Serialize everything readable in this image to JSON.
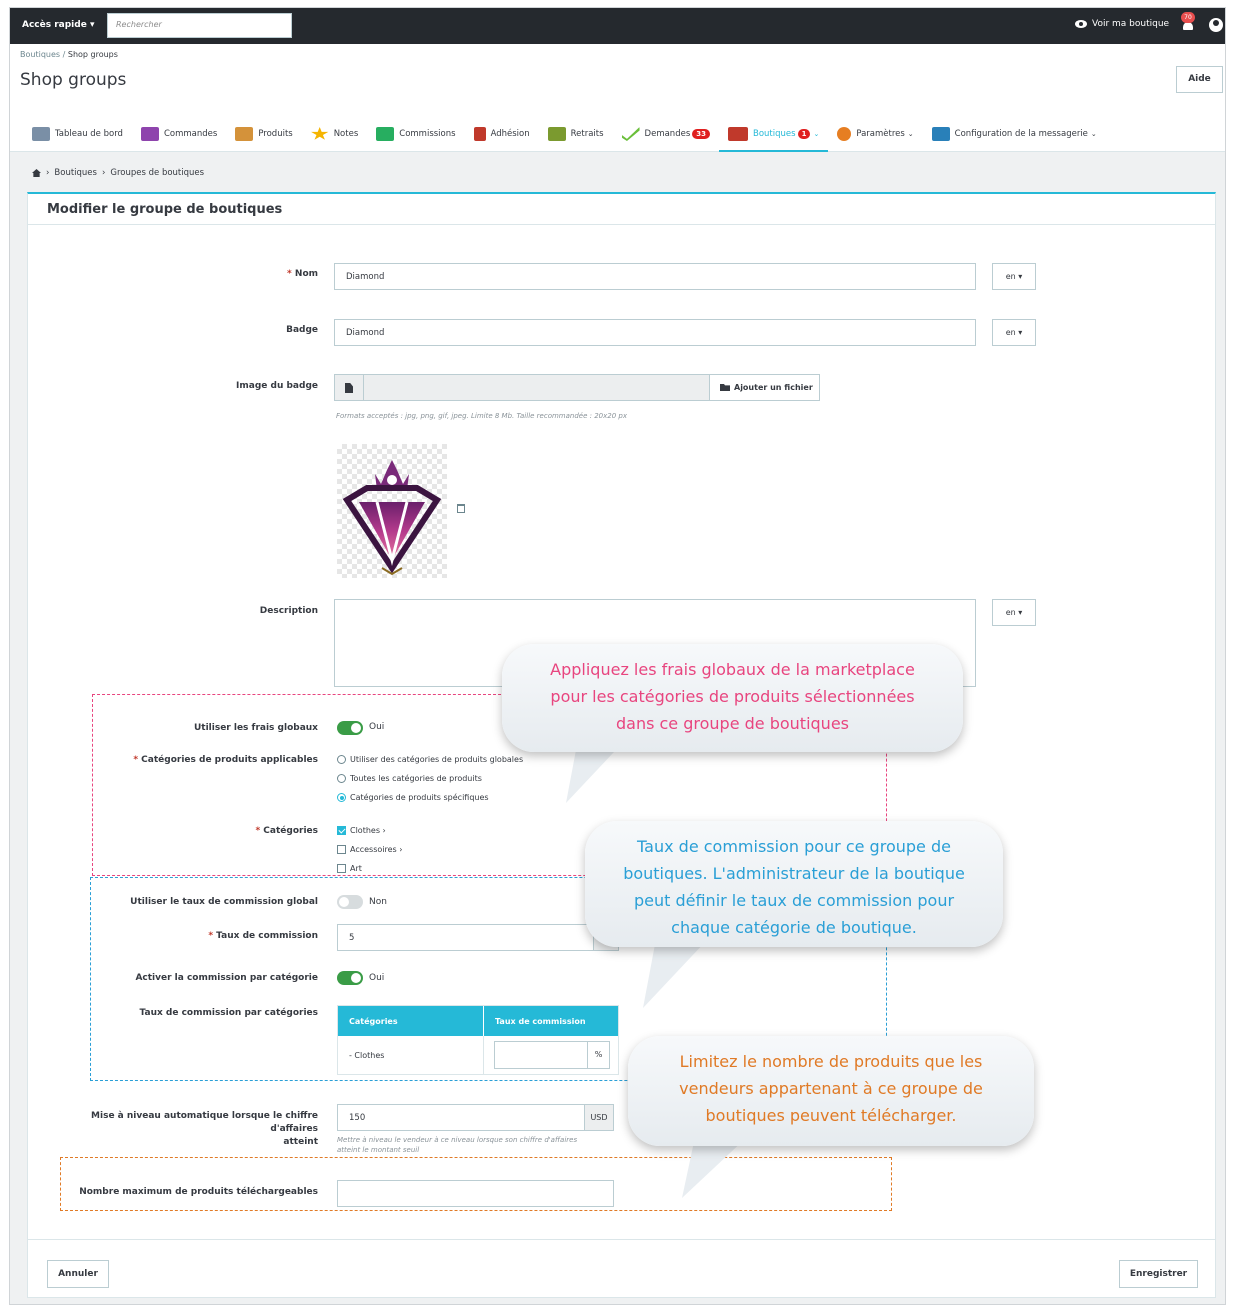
{
  "topbar": {
    "quick_access": "Accès rapide ▾",
    "search_placeholder": "Rechercher",
    "view_shop": "Voir ma boutique",
    "notif_count": "70"
  },
  "header": {
    "breadcrumb_parent": "Boutiques",
    "breadcrumb_sep": "/",
    "breadcrumb_current": "Shop groups",
    "title": "Shop groups",
    "help_label": "Aide"
  },
  "tabs": [
    {
      "label": "Tableau de bord",
      "color": "#7a8fa6"
    },
    {
      "label": "Commandes",
      "color": "#8e44ad"
    },
    {
      "label": "Produits",
      "color": "#d4923a"
    },
    {
      "label": "Notes",
      "color": "#f5b400"
    },
    {
      "label": "Commissions",
      "color": "#27ae60"
    },
    {
      "label": "Adhésion",
      "color": "#c0392b"
    },
    {
      "label": "Retraits",
      "color": "#7b9a2f"
    },
    {
      "label": "Demandes",
      "color": "#6abf3a",
      "count": "33"
    },
    {
      "label": "Boutiques",
      "color": "#c0392b",
      "count": "1",
      "active": true,
      "dropdown": true
    },
    {
      "label": "Paramètres",
      "color": "#e67e22",
      "dropdown": true
    },
    {
      "label": "Configuration de la messagerie",
      "color": "#2980b9",
      "dropdown": true
    }
  ],
  "nav_breadcrumb": {
    "sep1": "›",
    "item1": "Boutiques",
    "sep2": "›",
    "item2": "Groupes de boutiques"
  },
  "panel": {
    "title": "Modifier le groupe de boutiques"
  },
  "form": {
    "required_mark": "*",
    "nom_label": "Nom",
    "nom_value": "Diamond",
    "lang": "en ▾",
    "badge_label": "Badge",
    "badge_value": "Diamond",
    "badge_image_label": "Image du badge",
    "add_file": "Ajouter un fichier",
    "formats_help": "Formats acceptés : jpg, png, gif, jpeg. Limite 8 Mb. Taille recommandée : 20x20 px",
    "description_label": "Description",
    "desc_lang": "en ▾",
    "use_global_fees_label": "Utiliser les frais globaux",
    "use_global_fees_value": "Oui",
    "applicable_categories_label": "Catégories de produits applicables",
    "radio_options": [
      {
        "label": "Utiliser des catégories de produits globales",
        "selected": false
      },
      {
        "label": "Toutes les catégories de produits",
        "selected": false
      },
      {
        "label": "Catégories de produits spécifiques",
        "selected": true
      }
    ],
    "categories_label": "Catégories",
    "category_options": [
      {
        "label": "Clothes ›",
        "checked": true
      },
      {
        "label": "Accessoires ›",
        "checked": false
      },
      {
        "label": "Art",
        "checked": false
      }
    ],
    "use_global_commission_label": "Utiliser le taux de commission global",
    "use_global_commission_value": "Non",
    "commission_rate_label": "Taux de commission",
    "commission_rate_value": "5",
    "commission_rate_unit": "%",
    "per_category_label": "Activer la commission par catégorie",
    "per_category_value": "Oui",
    "rates_by_category_label": "Taux de commission par catégories",
    "table_headers": [
      "Catégories",
      "Taux de commission"
    ],
    "table_rows": [
      {
        "category": "- Clothes",
        "rate": "",
        "unit": "%"
      }
    ],
    "auto_upgrade_label_1": "Mise à niveau automatique lorsque le chiffre d'affaires",
    "auto_upgrade_label_2": "atteint",
    "auto_upgrade_value": "150",
    "auto_upgrade_unit": "USD",
    "auto_upgrade_help_1": "Mettre à niveau le vendeur à ce niveau lorsque son chiffre d'affaires",
    "auto_upgrade_help_2": "atteint le montant seuil",
    "max_products_label": "Nombre maximum de produits téléchargeables",
    "max_products_value": ""
  },
  "footer": {
    "cancel": "Annuler",
    "save": "Enregistrer"
  },
  "callouts": {
    "fees": [
      "Appliquez les frais globaux de la marketplace",
      "pour les catégories de produits sélectionnées",
      "dans ce groupe de boutiques"
    ],
    "commission": [
      "Taux de commission pour ce groupe de",
      "boutiques. L'administrateur de la boutique",
      "peut définir le taux de commission pour",
      "chaque catégorie de boutique."
    ],
    "limit": [
      "Limitez le nombre de produits que les",
      "vendeurs appartenant à ce groupe de",
      "boutiques peuvent télécharger."
    ],
    "colors": {
      "fees": "#e8457f",
      "commission": "#2a9fd6",
      "limit": "#e07a26"
    }
  },
  "colors": {
    "topbar": "#25292e",
    "accent": "#25b9d7",
    "switch_on": "#3a9c46",
    "badge_red": "#e02020"
  }
}
